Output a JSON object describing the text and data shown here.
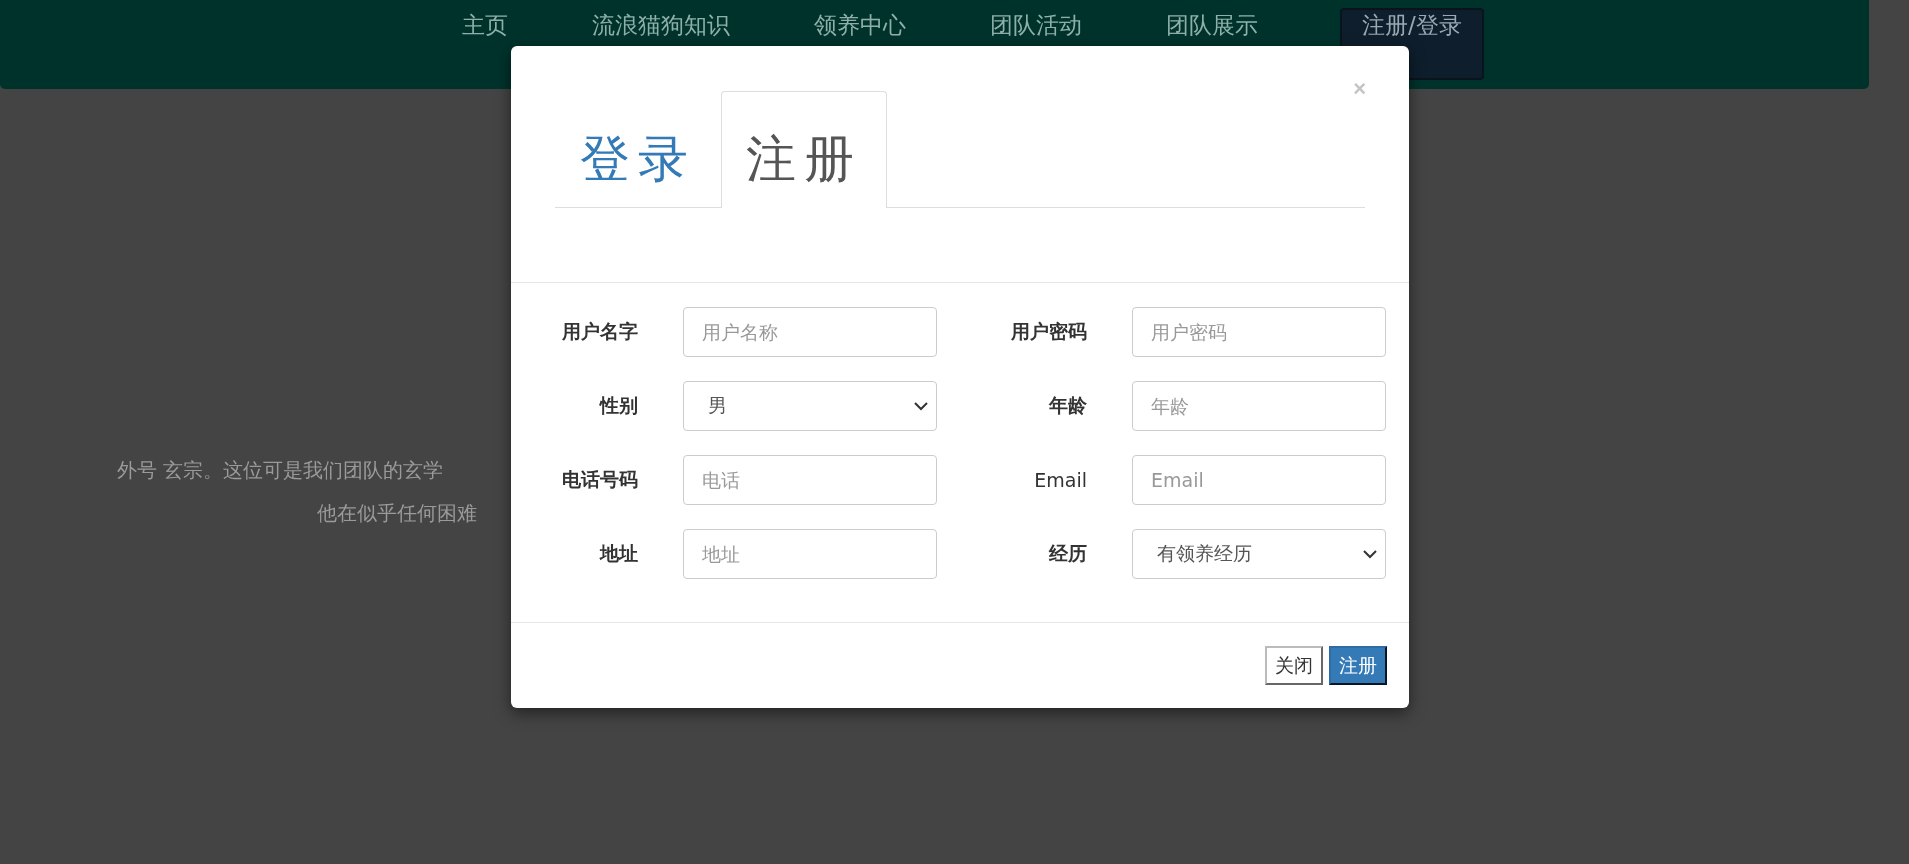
{
  "navbar": {
    "items": [
      {
        "label": "主页"
      },
      {
        "label": "流浪猫狗知识"
      },
      {
        "label": "领养中心"
      },
      {
        "label": "团队活动"
      },
      {
        "label": "团队展示"
      }
    ],
    "button": "注册/登录"
  },
  "background_text": [
    "外号 玄宗。这位可是我们团队的玄学",
    "他在似乎任何困难"
  ],
  "modal": {
    "tabs": [
      {
        "label": "登录",
        "selected": false
      },
      {
        "label": "注册",
        "selected": true
      }
    ],
    "close": "×",
    "fields": [
      {
        "label": "用户名字",
        "kind": "input",
        "placeholder": "用户名称"
      },
      {
        "label": "用户密码",
        "kind": "input",
        "placeholder": "用户密码"
      },
      {
        "label": "性别",
        "kind": "select",
        "value": "男"
      },
      {
        "label": "年龄",
        "kind": "input",
        "placeholder": "年龄"
      },
      {
        "label": "电话号码",
        "kind": "input",
        "placeholder": "电话"
      },
      {
        "label": "Email",
        "kind": "input",
        "placeholder": "Email"
      },
      {
        "label": "地址",
        "kind": "input",
        "placeholder": "地址"
      },
      {
        "label": "经历",
        "kind": "select",
        "value": "有领养经历"
      }
    ],
    "buttons": [
      {
        "label": "关闭",
        "kind": "default"
      },
      {
        "label": "注册",
        "kind": "primary"
      }
    ]
  }
}
